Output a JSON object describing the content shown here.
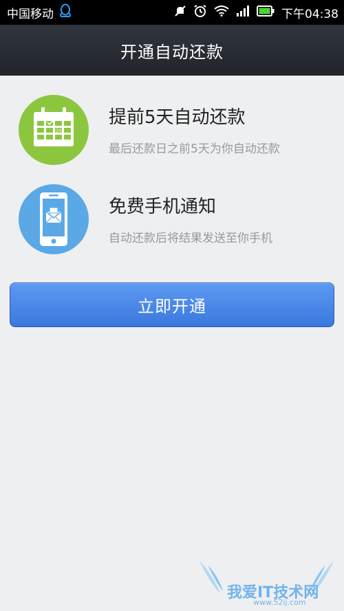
{
  "status_bar": {
    "carrier": "中国移动",
    "time": "下午04:38",
    "icons": [
      "qq-icon",
      "mute-icon",
      "alarm-icon",
      "wifi-icon",
      "signal-icon",
      "battery-icon"
    ]
  },
  "header": {
    "title": "开通自动还款"
  },
  "features": [
    {
      "title": "提前5天自动还款",
      "description": "最后还款日之前5天为你自动还款",
      "icon": "calendar-icon",
      "icon_number": "20",
      "color": "#8cc63f"
    },
    {
      "title": "免费手机通知",
      "description": "自动还款后将结果发送至你手机",
      "icon": "phone-message-icon",
      "color": "#5aa9e6"
    }
  ],
  "button": {
    "label": "立即开通"
  },
  "watermark": {
    "name": "我爱IT技术网",
    "url": "www.52ij.com"
  }
}
